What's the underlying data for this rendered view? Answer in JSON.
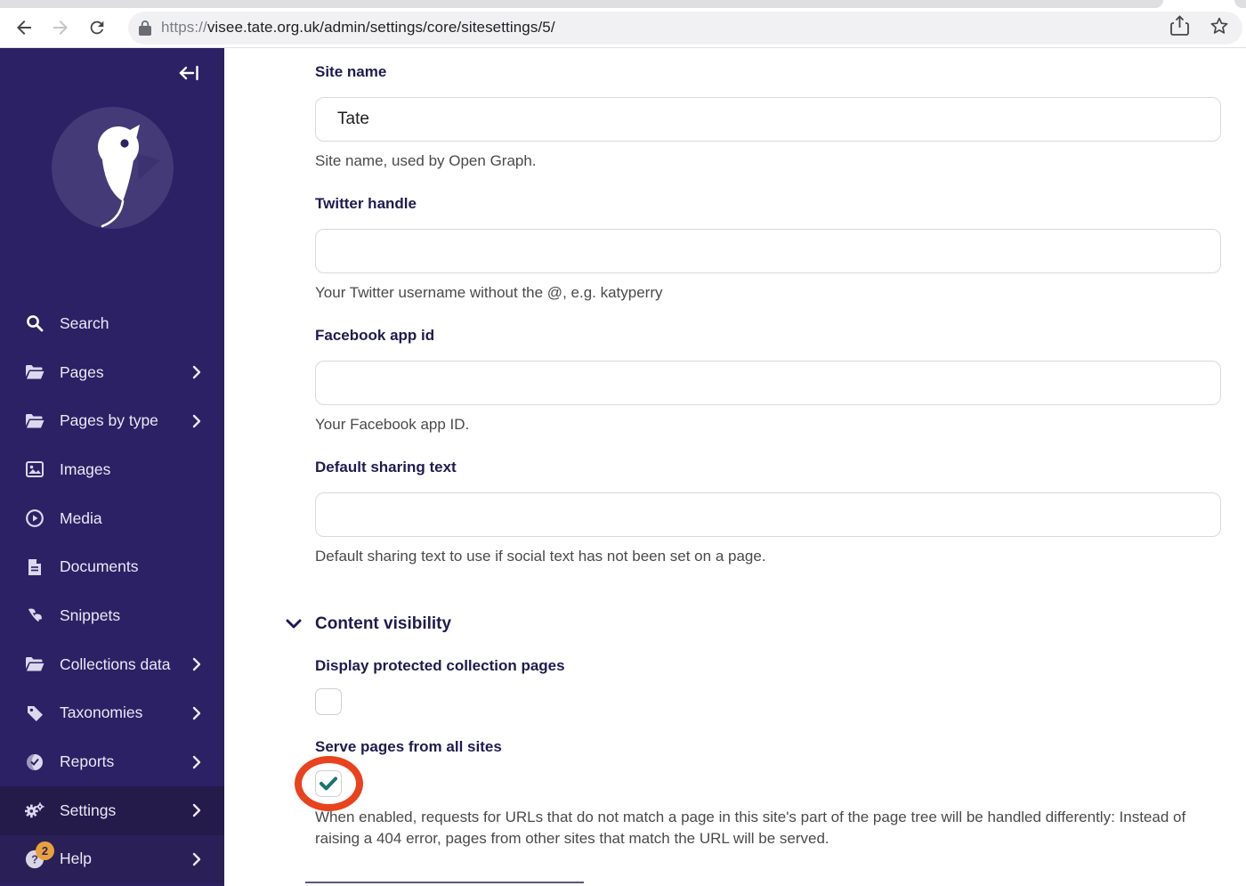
{
  "browser": {
    "url_scheme": "https://",
    "url_rest": "visee.tate.org.uk/admin/settings/core/sitesettings/5/",
    "back_icon": "back-arrow",
    "forward_icon": "forward-arrow",
    "reload_icon": "reload",
    "lock_icon": "padlock",
    "share_icon": "share",
    "bookmark_icon": "star"
  },
  "sidebar": {
    "collapse_icon": "collapse-sidebar",
    "logo": "wagtail-bird-logo",
    "items": [
      {
        "label": "Search",
        "icon": "search-icon",
        "has_chevron": false,
        "active": false
      },
      {
        "label": "Pages",
        "icon": "folder-icon",
        "has_chevron": true,
        "active": false
      },
      {
        "label": "Pages by type",
        "icon": "folder-icon",
        "has_chevron": true,
        "active": false
      },
      {
        "label": "Images",
        "icon": "image-icon",
        "has_chevron": false,
        "active": false
      },
      {
        "label": "Media",
        "icon": "play-circle-icon",
        "has_chevron": false,
        "active": false
      },
      {
        "label": "Documents",
        "icon": "document-icon",
        "has_chevron": false,
        "active": false
      },
      {
        "label": "Snippets",
        "icon": "snippet-icon",
        "has_chevron": false,
        "active": false
      },
      {
        "label": "Collections data",
        "icon": "folder-icon",
        "has_chevron": true,
        "active": false
      },
      {
        "label": "Taxonomies",
        "icon": "tag-icon",
        "has_chevron": true,
        "active": false
      },
      {
        "label": "Reports",
        "icon": "globe-icon",
        "has_chevron": true,
        "active": false
      },
      {
        "label": "Settings",
        "icon": "gears-icon",
        "has_chevron": true,
        "active": true
      },
      {
        "label": "Help",
        "icon": "question-icon",
        "has_chevron": true,
        "active": false,
        "badge": "2"
      }
    ]
  },
  "form": {
    "fields": [
      {
        "label": "Site name",
        "value": "Tate",
        "help": "Site name, used by Open Graph."
      },
      {
        "label": "Twitter handle",
        "value": "",
        "help": "Your Twitter username without the @, e.g. katyperry"
      },
      {
        "label": "Facebook app id",
        "value": "",
        "help": "Your Facebook app ID."
      },
      {
        "label": "Default sharing text",
        "value": "",
        "help": "Default sharing text to use if social text has not been set on a page."
      }
    ],
    "section": {
      "title": "Content visibility",
      "checkboxes": [
        {
          "label": "Display protected collection pages",
          "checked": false
        },
        {
          "label": "Serve pages from all sites",
          "checked": true,
          "annotated": true
        }
      ],
      "serve_help": "When enabled, requests for URLs that do not match a page in this site's part of the page tree will be handled differently: Instead of raising a 404 error, pages from other sites that match the URL will be served."
    }
  },
  "colors": {
    "sidebar_bg": "#2b2164",
    "sidebar_active_bg": "#241b4b",
    "sidebar_footer_bg": "#2a2057",
    "logo_circle": "#453a78",
    "label_indigo": "#1f1b50",
    "help_grey": "#4a4a4a",
    "check_teal": "#17756d",
    "annotation_red": "#e8431e",
    "badge_orange": "#e9a13b"
  }
}
